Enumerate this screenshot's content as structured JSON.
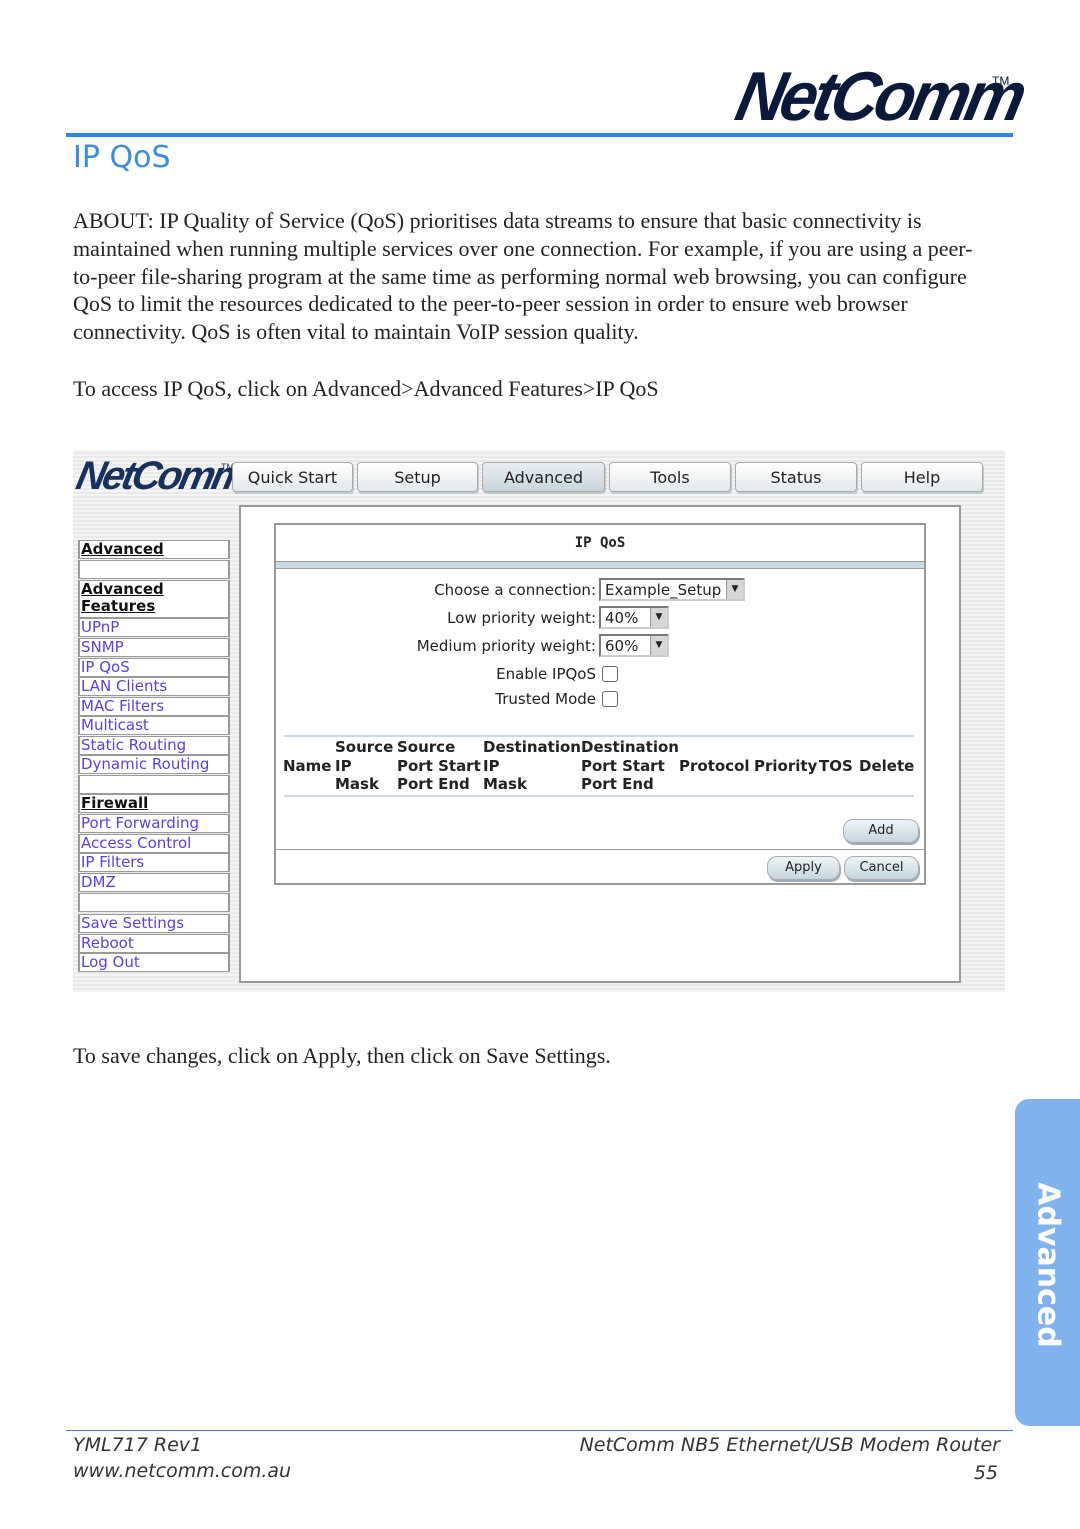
{
  "header": {
    "logo": "NetComm",
    "trademark": "TM"
  },
  "page_title": "IP QoS",
  "about": "ABOUT: IP Quality of Service (QoS) prioritises data streams to ensure that basic connectivity is maintained when running multiple services over one connection. For example, if you are using a peer-to-peer file-sharing program at the same time as performing normal web browsing, you can configure QoS to limit the resources dedicated to the peer-to-peer session in order to ensure web browser connectivity. QoS is often vital to maintain VoIP session quality.",
  "access_text": "To access IP QoS, click on Advanced>Advanced Features>IP QoS",
  "save_text": "To save changes, click on Apply, then click on Save Settings.",
  "screenshot": {
    "logo": "NetComm",
    "trademark": "TM",
    "tabs": [
      "Quick Start",
      "Setup",
      "Advanced",
      "Tools",
      "Status",
      "Help"
    ],
    "active_tab": "Advanced",
    "sidebar": [
      "Advanced",
      "",
      "Advanced Features",
      "UPnP",
      "SNMP",
      "IP QoS",
      "LAN Clients",
      "MAC Filters",
      "Multicast",
      "Static Routing",
      "Dynamic Routing",
      "",
      "Firewall",
      "Port Forwarding",
      "Access Control",
      "IP Filters",
      "DMZ",
      "",
      "Save Settings",
      "Reboot",
      "Log Out"
    ],
    "panel": {
      "title": "IP QoS",
      "connection_label": "Choose a connection:",
      "connection_value": "Example_Setup",
      "low_label": "Low priority weight:",
      "low_value": "40%",
      "medium_label": "Medium priority weight:",
      "medium_value": "60%",
      "enable_label": "Enable IPQoS",
      "enable_checked": false,
      "trusted_label": "Trusted Mode",
      "trusted_checked": false,
      "columns": {
        "name": "Name",
        "src_ip": [
          "Source",
          "IP",
          "Mask"
        ],
        "src_port": [
          "Source",
          "Port Start",
          "Port End"
        ],
        "dst_ip": [
          "Destination",
          "IP",
          "Mask"
        ],
        "dst_port": [
          "Destination",
          "Port Start",
          "Port End"
        ],
        "protocol": "Protocol",
        "priority": "Priority",
        "tos": "TOS",
        "delete": "Delete"
      },
      "add": "Add",
      "apply": "Apply",
      "cancel": "Cancel"
    }
  },
  "side_tab": "Advanced",
  "footer": {
    "doc_id": "YML717 Rev1",
    "website": "www.netcomm.com.au",
    "product": "NetComm NB5 Ethernet/USB Modem Router",
    "page": "55"
  }
}
